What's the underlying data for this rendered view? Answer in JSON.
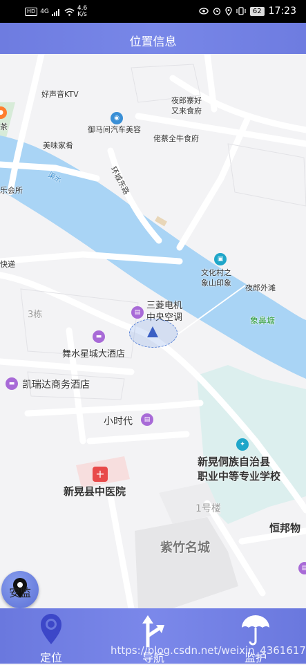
{
  "status_bar": {
    "hd": "HD",
    "network": "4G",
    "speed_value": "4.6",
    "speed_unit": "K/s",
    "battery": "62",
    "time": "17:23"
  },
  "header": {
    "title": "位置信息"
  },
  "map": {
    "labels": {
      "ktv": "好声音KTV",
      "yelang_food": "夜郎寨好\n又来食府",
      "car_service": "御马间汽车美容",
      "laocai": "佬蔡全牛食府",
      "meiwei": "美味家肴",
      "cha": "茶",
      "river": "渠水",
      "road": "环城东路",
      "club": "乐会所",
      "wenhua": "文化村之\n象山印象",
      "yelang_beach": "夜郎外滩",
      "xiangbitang": "象鼻塘",
      "kuaidi": "快递",
      "building3": "3栋",
      "mitsubishi": "三菱电机\n中央空调",
      "wushui_hotel": "舞水星城大酒店",
      "kairuida": "凯瑞达商务酒店",
      "xiaoshidai": "小时代",
      "school": "新晃侗族自治县\n职业中等专业学校",
      "hospital": "新晃县中医院",
      "building1": "1号楼",
      "zizhu": "紫竹名城",
      "hengbang": "恒邦物"
    }
  },
  "fab": {
    "label": "安监"
  },
  "tabs": [
    {
      "label": "定位",
      "icon": "location-pin-icon"
    },
    {
      "label": "导航",
      "icon": "navigation-arrow-icon"
    },
    {
      "label": "监护",
      "icon": "umbrella-icon"
    }
  ],
  "watermark": "https://blog.csdn.net/weixin_43616178"
}
